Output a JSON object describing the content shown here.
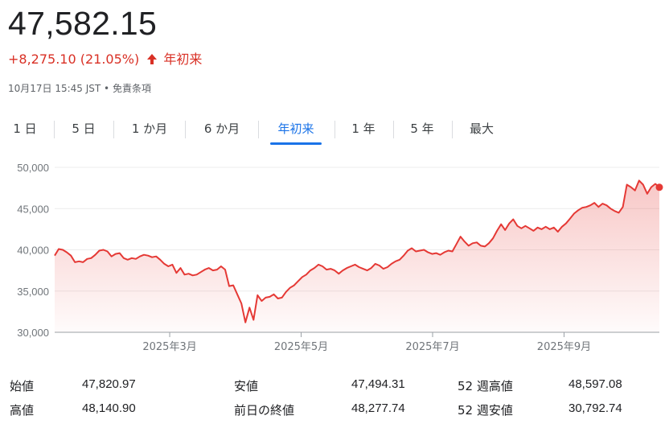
{
  "header": {
    "price": "47,582.15",
    "change": "+8,275.10 (21.05%)",
    "period_label": "年初来",
    "meta": "10月17日 15:45 JST • 免責条項",
    "accent_color": "#d93025"
  },
  "tabs": [
    "1 日",
    "5 日",
    "1 か月",
    "6 か月",
    "年初来",
    "1 年",
    "5 年",
    "最大"
  ],
  "active_tab": "年初来",
  "chart_data": {
    "type": "area",
    "title": "",
    "xlabel": "",
    "ylabel": "",
    "ylim": [
      30000,
      50000
    ],
    "yticks": [
      "50,000",
      "45,000",
      "40,000",
      "35,000",
      "30,000"
    ],
    "xticks": [
      "2025年3月",
      "2025年5月",
      "2025年7月",
      "2025年9月"
    ],
    "line_color": "#e53935",
    "grid": true,
    "series": [
      {
        "values": [
          39300,
          40100,
          40000,
          39700,
          39300,
          38500,
          38600,
          38500,
          38900,
          39000,
          39400,
          39900,
          40000,
          39800,
          39200,
          39500,
          39600,
          39000,
          38800,
          39000,
          38900,
          39200,
          39400,
          39300,
          39100,
          39200,
          38800,
          38300,
          38000,
          38200,
          37200,
          37800,
          37000,
          37100,
          36900,
          37000,
          37300,
          37600,
          37800,
          37500,
          37600,
          38000,
          37600,
          35600,
          35700,
          34600,
          33500,
          31200,
          33000,
          31500,
          34500,
          33800,
          34200,
          34300,
          34600,
          34100,
          34200,
          34900,
          35400,
          35700,
          36200,
          36700,
          37000,
          37500,
          37800,
          38200,
          38000,
          37600,
          37700,
          37500,
          37100,
          37500,
          37800,
          38000,
          38200,
          37900,
          37700,
          37500,
          37800,
          38300,
          38100,
          37700,
          37900,
          38300,
          38600,
          38800,
          39300,
          39900,
          40200,
          39800,
          39900,
          40000,
          39700,
          39500,
          39600,
          39400,
          39700,
          39900,
          39800,
          40700,
          41600,
          41000,
          40500,
          40800,
          40900,
          40500,
          40400,
          40800,
          41400,
          42300,
          43100,
          42400,
          43200,
          43700,
          42900,
          42600,
          42900,
          42600,
          42300,
          42700,
          42500,
          42800,
          42500,
          42700,
          42200,
          42800,
          43200,
          43800,
          44400,
          44800,
          45100,
          45200,
          45400,
          45700,
          45200,
          45600,
          45400,
          45000,
          44700,
          44500,
          45200,
          47900,
          47600,
          47200,
          48400,
          47900,
          46800,
          47600,
          48000,
          47582
        ]
      }
    ]
  },
  "stats": [
    {
      "label": "始値",
      "value": "47,820.97"
    },
    {
      "label": "高値",
      "value": "48,140.90"
    },
    {
      "label": "安値",
      "value": "47,494.31"
    },
    {
      "label": "前日の終値",
      "value": "48,277.74"
    },
    {
      "label": "52 週高値",
      "value": "48,597.08"
    },
    {
      "label": "52 週安値",
      "value": "30,792.74"
    }
  ]
}
